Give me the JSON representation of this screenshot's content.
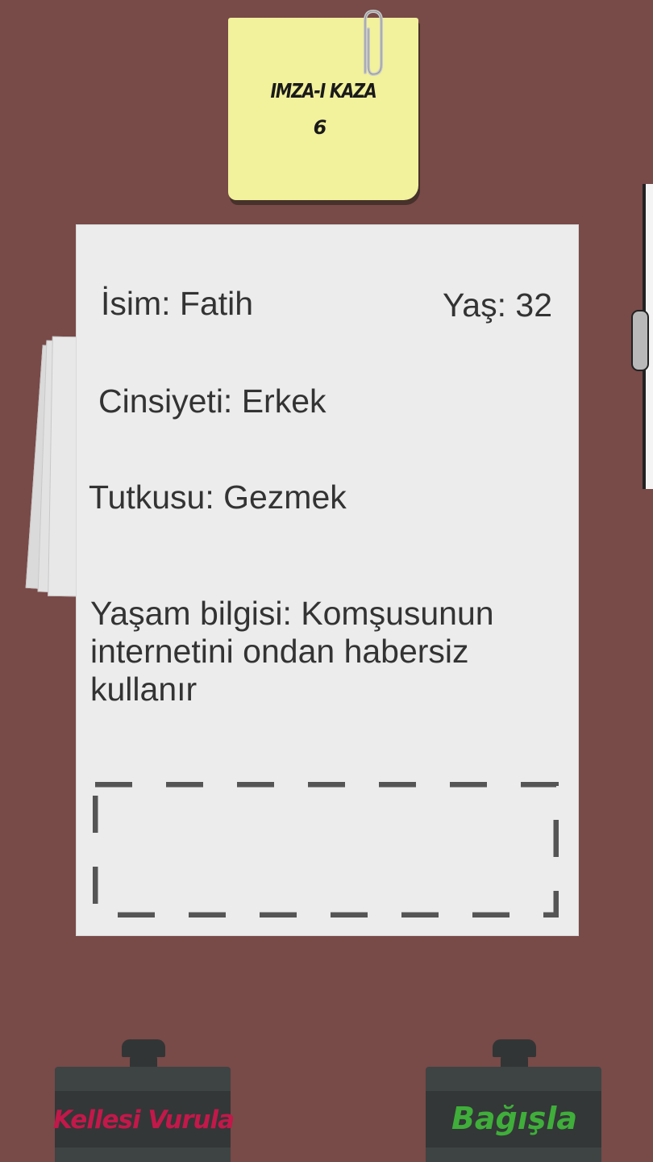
{
  "case_note": {
    "title": "IMZA-I KAZA",
    "number": "6"
  },
  "document": {
    "name": "İsim: Fatih",
    "age": "Yaş: 32",
    "gender": "Cinsiyeti: Erkek",
    "passion": "Tutkusu: Gezmek",
    "life_info": "Yaşam bilgisi: Komşusunun internetini ondan habersiz kullanır"
  },
  "actions": {
    "execute_label": "Kellesi Vurula",
    "execute_color": "#c2184a",
    "pardon_label": "Bağışla",
    "pardon_color": "#3fae3a"
  },
  "colors": {
    "background": "#784a48",
    "sticky_note": "#f2f19c",
    "paper": "#ececec"
  }
}
